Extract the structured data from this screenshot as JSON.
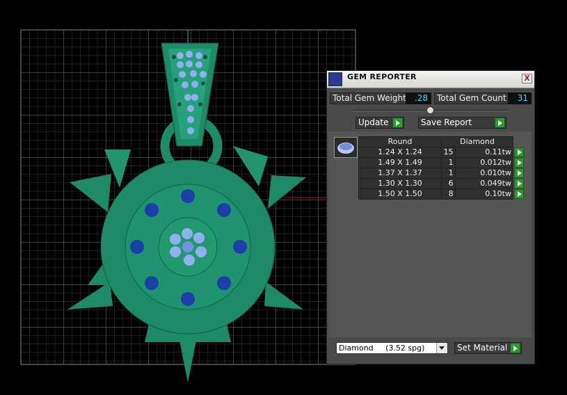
{
  "panel": {
    "title": "GEM REPORTER",
    "close_label": "X",
    "total_weight_label": "Total Gem Weight",
    "total_weight_value": ".28",
    "total_count_label": "Total Gem Count",
    "total_count_value": "31",
    "update_label": "Update",
    "save_report_label": "Save Report",
    "table": {
      "headers": [
        "Round",
        "Diamond"
      ],
      "rows": [
        {
          "size": "1.24 X 1.24",
          "count": "15",
          "weight": "0.11tw"
        },
        {
          "size": "1.49 X 1.49",
          "count": "1",
          "weight": "0.012tw"
        },
        {
          "size": "1.37 X 1.37",
          "count": "1",
          "weight": "0.010tw"
        },
        {
          "size": "1.30 X 1.30",
          "count": "6",
          "weight": "0.049tw"
        },
        {
          "size": "1.50 X 1.50",
          "count": "8",
          "weight": "0.10tw"
        }
      ]
    },
    "material_value": "Diamond     (3.52 spg)",
    "set_material_label": "Set Material"
  },
  "colors": {
    "model": "#1e8a68",
    "gem": "#1c3fa8",
    "accent_value": "#5fd5f0",
    "go_button": "#2e9a2e"
  }
}
